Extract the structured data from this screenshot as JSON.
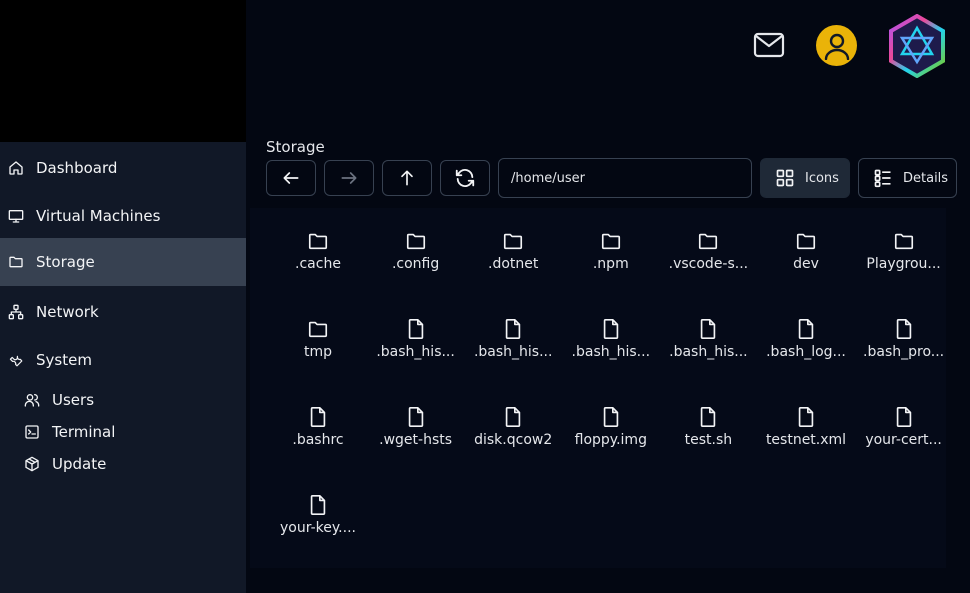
{
  "sidebar": {
    "items": [
      {
        "label": "Dashboard",
        "icon": "home-icon"
      },
      {
        "label": "Virtual Machines",
        "icon": "monitor-icon"
      },
      {
        "label": "Storage",
        "icon": "folder-icon",
        "active": true
      },
      {
        "label": "Network",
        "icon": "network-icon"
      },
      {
        "label": "System",
        "icon": "wrench-icon"
      }
    ],
    "sub_items": [
      {
        "label": "Users",
        "icon": "users-icon"
      },
      {
        "label": "Terminal",
        "icon": "terminal-icon"
      },
      {
        "label": "Update",
        "icon": "package-icon"
      }
    ]
  },
  "header": {
    "mail_icon": "mail-icon",
    "user_icon": "user-icon",
    "logo": "hexagon-logo"
  },
  "storage": {
    "title": "Storage",
    "path": "/home/user",
    "view_icons_label": "Icons",
    "view_details_label": "Details",
    "files": [
      {
        "name": ".cache",
        "type": "folder"
      },
      {
        "name": ".config",
        "type": "folder"
      },
      {
        "name": ".dotnet",
        "type": "folder"
      },
      {
        "name": ".npm",
        "type": "folder"
      },
      {
        "name": ".vscode-s...",
        "type": "folder"
      },
      {
        "name": "dev",
        "type": "folder"
      },
      {
        "name": "Playgrou...",
        "type": "folder"
      },
      {
        "name": "tmp",
        "type": "folder"
      },
      {
        "name": ".bash_his...",
        "type": "file"
      },
      {
        "name": ".bash_his...",
        "type": "file"
      },
      {
        "name": ".bash_his...",
        "type": "file"
      },
      {
        "name": ".bash_his...",
        "type": "file"
      },
      {
        "name": ".bash_log...",
        "type": "file"
      },
      {
        "name": ".bash_pro...",
        "type": "file"
      },
      {
        "name": ".bashrc",
        "type": "file"
      },
      {
        "name": ".wget-hsts",
        "type": "file"
      },
      {
        "name": "disk.qcow2",
        "type": "file"
      },
      {
        "name": "floppy.img",
        "type": "file"
      },
      {
        "name": "test.sh",
        "type": "file"
      },
      {
        "name": "testnet.xml",
        "type": "file"
      },
      {
        "name": "your-cert...",
        "type": "file"
      },
      {
        "name": "your-key....",
        "type": "file"
      }
    ]
  },
  "colors": {
    "accent": "#eab308",
    "sidebar_bg": "#111827",
    "active_bg": "#374151",
    "page_bg": "#030712"
  }
}
